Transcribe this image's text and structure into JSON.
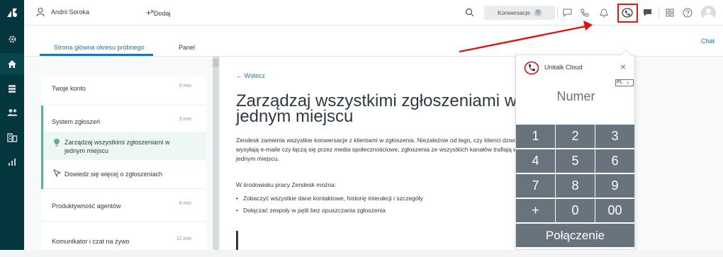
{
  "nav": {
    "items": [
      {
        "icon": "zendesk-logo-icon"
      },
      {
        "icon": "gear-icon"
      },
      {
        "icon": "home-icon"
      },
      {
        "icon": "tickets-icon"
      },
      {
        "icon": "users-icon"
      },
      {
        "icon": "organizations-icon"
      },
      {
        "icon": "reports-icon"
      }
    ]
  },
  "topbar": {
    "tab_user": "Andrii Soroka",
    "tab_close": "×",
    "add_tab": "Dodaj",
    "add_plus": "+",
    "conversations_label": "Konwersacje",
    "conversations_count": "0"
  },
  "subheader": {
    "tabs": [
      {
        "label": "Strona główna okresu próbnego",
        "active": true
      },
      {
        "label": "Panel",
        "active": false
      }
    ],
    "chat_link": "Chat"
  },
  "sidebar": {
    "sections": [
      {
        "title": "Twoje konto",
        "duration": "5 min"
      },
      {
        "title": "System zgłoszeń",
        "duration": "3 min"
      },
      {
        "title": "Produktywność agentów",
        "duration": "8 min"
      },
      {
        "title": "Komunikator i czat na żywo",
        "duration": "12 min"
      }
    ],
    "lessons": [
      {
        "label": "Zarządzaj wszystkimi zgłoszeniami w jednym miejscu",
        "current": true
      },
      {
        "label": "Dowiedz się więcej o zgłoszeniach",
        "current": false
      }
    ]
  },
  "content": {
    "back": "Wstecz",
    "back_arrow": "←",
    "heading": "Zarządzaj wszystkimi zgłoszeniami w\njednym miejscu",
    "paragraph": "Zendesk zamienia wszystkie konwersacje z klientami w zgłoszenia. Niezależnie od tego, czy klienci dzwonią, wysyłają e-maile czy łączą się przez media społecznościowe, zgłoszenia ze wszystkich kanałów trafiają w jednym miejscu.",
    "intro": "W środowisku pracy Zendesk można:",
    "bullets": [
      "Zobaczyć wszystkie dane kontaktowe, historię interakcji i szczegóły",
      "Dołączać zespoły w pętli bez opuszczania zgłoszenia"
    ]
  },
  "dialer": {
    "brand": "Unitalk Cloud",
    "close": "×",
    "language": "PL",
    "language_caret": "⌄",
    "number_placeholder": "Numer",
    "keys": [
      "1",
      "2",
      "3",
      "4",
      "5",
      "6",
      "7",
      "8",
      "9",
      "+",
      "0",
      "00"
    ],
    "connect_label": "Połączenie"
  },
  "colors": {
    "nav_bg": "#03363d",
    "accent_blue": "#1f73b7",
    "active_green": "#5eae91",
    "highlight_red": "#e11111",
    "keypad_gray": "#68737d"
  }
}
